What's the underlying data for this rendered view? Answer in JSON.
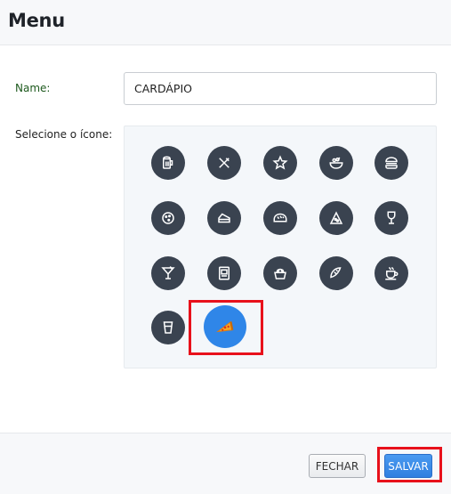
{
  "header": {
    "title": "Menu"
  },
  "form": {
    "name_label": "Name:",
    "name_value": "CARDÁPIO",
    "icon_label": "Selecione o ícone:"
  },
  "icons": [
    "beer-mug-icon",
    "fork-knife-icon",
    "star-icon",
    "salad-bowl-icon",
    "burger-icon",
    "cookie-icon",
    "cake-slice-icon",
    "bread-icon",
    "pizza-slice-icon",
    "wine-glass-icon",
    "cocktail-icon",
    "menu-board-icon",
    "takeaway-box-icon",
    "taco-icon",
    "coffee-cup-icon",
    "drink-cup-icon",
    "pizza-selected-icon"
  ],
  "selected_icon": "pizza-selected-icon",
  "footer": {
    "close_label": "FECHAR",
    "save_label": "SALVAR"
  },
  "colors": {
    "icon_bg": "#3a4350",
    "selected_bg": "#2f86e8",
    "highlight": "#e8111b",
    "save_bg": "#2f7fe0"
  }
}
